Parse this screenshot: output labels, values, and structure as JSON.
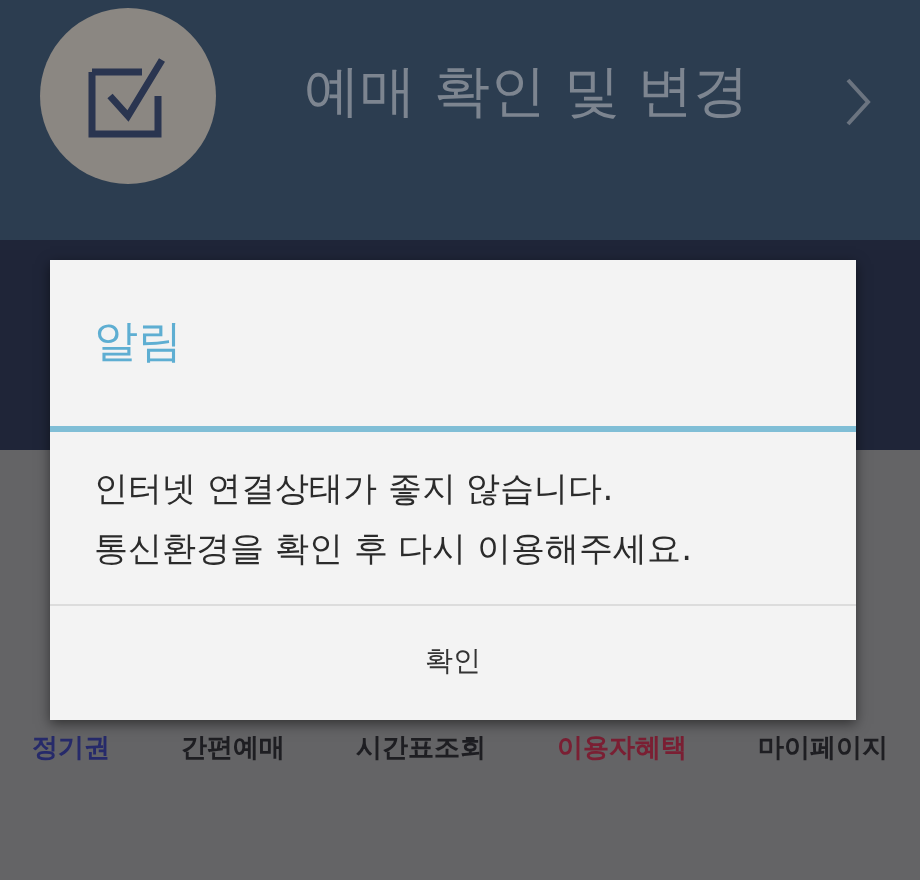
{
  "header": {
    "title": "예매 확인 및 변경"
  },
  "dialog": {
    "title": "알림",
    "message": [
      "인터넷 연결상태가 좋지 않습니다.",
      "통신환경을 확인 후 다시 이용해주세요."
    ],
    "button": "확인"
  },
  "bottom_nav": [
    {
      "label": "정기권",
      "color": "#262a6a"
    },
    {
      "label": "간편예매",
      "color": "#1e1e22"
    },
    {
      "label": "시간표조회",
      "color": "#1e1e22"
    },
    {
      "label": "이용자혜택",
      "color": "#7a1f33"
    },
    {
      "label": "마이페이지",
      "color": "#1e1e22"
    }
  ]
}
